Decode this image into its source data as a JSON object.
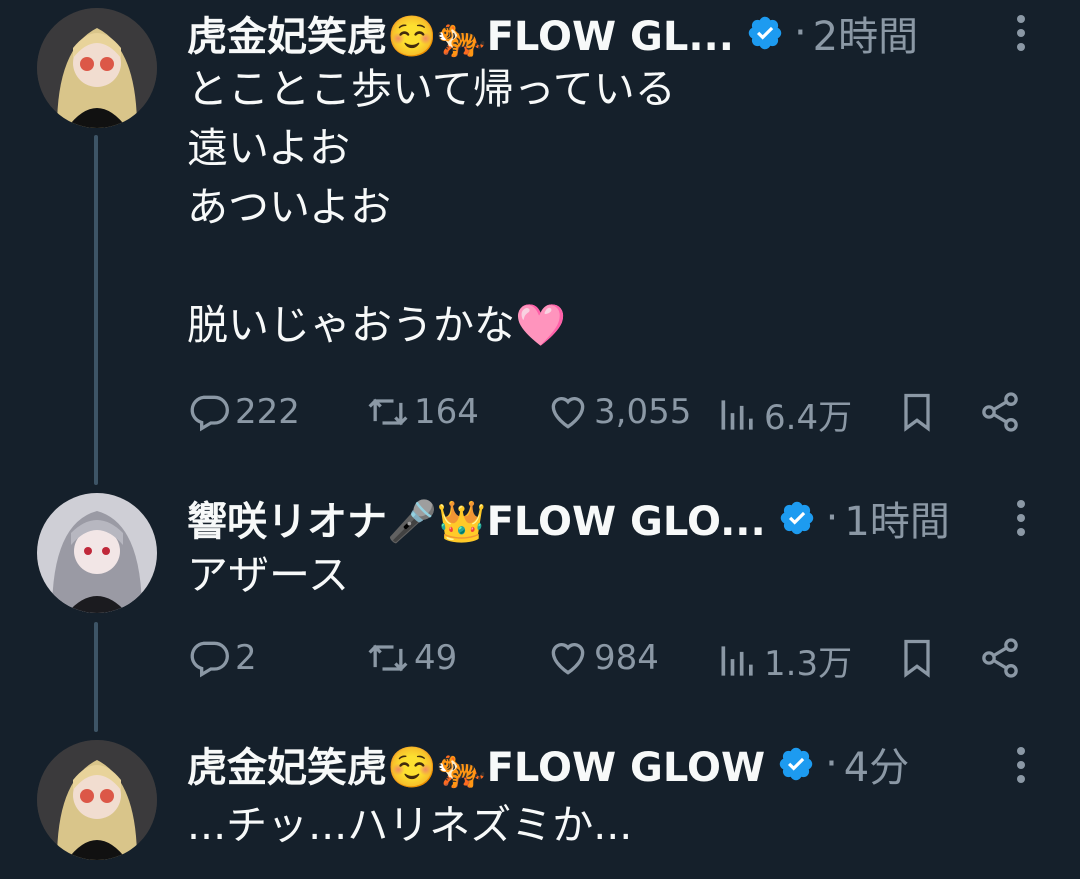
{
  "tweets": [
    {
      "author": "虎金妃笑虎☺️🐅FLOW GL...",
      "time": "2時間",
      "text": "とことこ歩いて帰っている\n遠いよお\nあついよお\n\n脱いじゃおうかな🩷",
      "reply_count": "222",
      "retweet_count": "164",
      "like_count": "3,055",
      "view_count": "6.4万"
    },
    {
      "author": "響咲リオナ🎤👑FLOW GLO...",
      "time": "1時間",
      "text": "アザース",
      "reply_count": "2",
      "retweet_count": "49",
      "like_count": "984",
      "view_count": "1.3万"
    },
    {
      "author": "虎金妃笑虎☺️🐅FLOW GLOW",
      "time": "4分",
      "text": "...チッ...ハリネズミか..."
    }
  ],
  "separator": "·",
  "icons": {
    "verified": "verified-badge-icon",
    "more": "more-vertical-icon",
    "reply": "reply-icon",
    "retweet": "retweet-icon",
    "like": "heart-icon",
    "views": "views-chart-icon",
    "bookmark": "bookmark-icon",
    "share": "share-icon"
  },
  "colors": {
    "background": "#15202b",
    "text": "#f7f9f9",
    "secondary": "#8b98a5",
    "verified": "#1d9bf0",
    "thread_line": "#3d5466"
  }
}
